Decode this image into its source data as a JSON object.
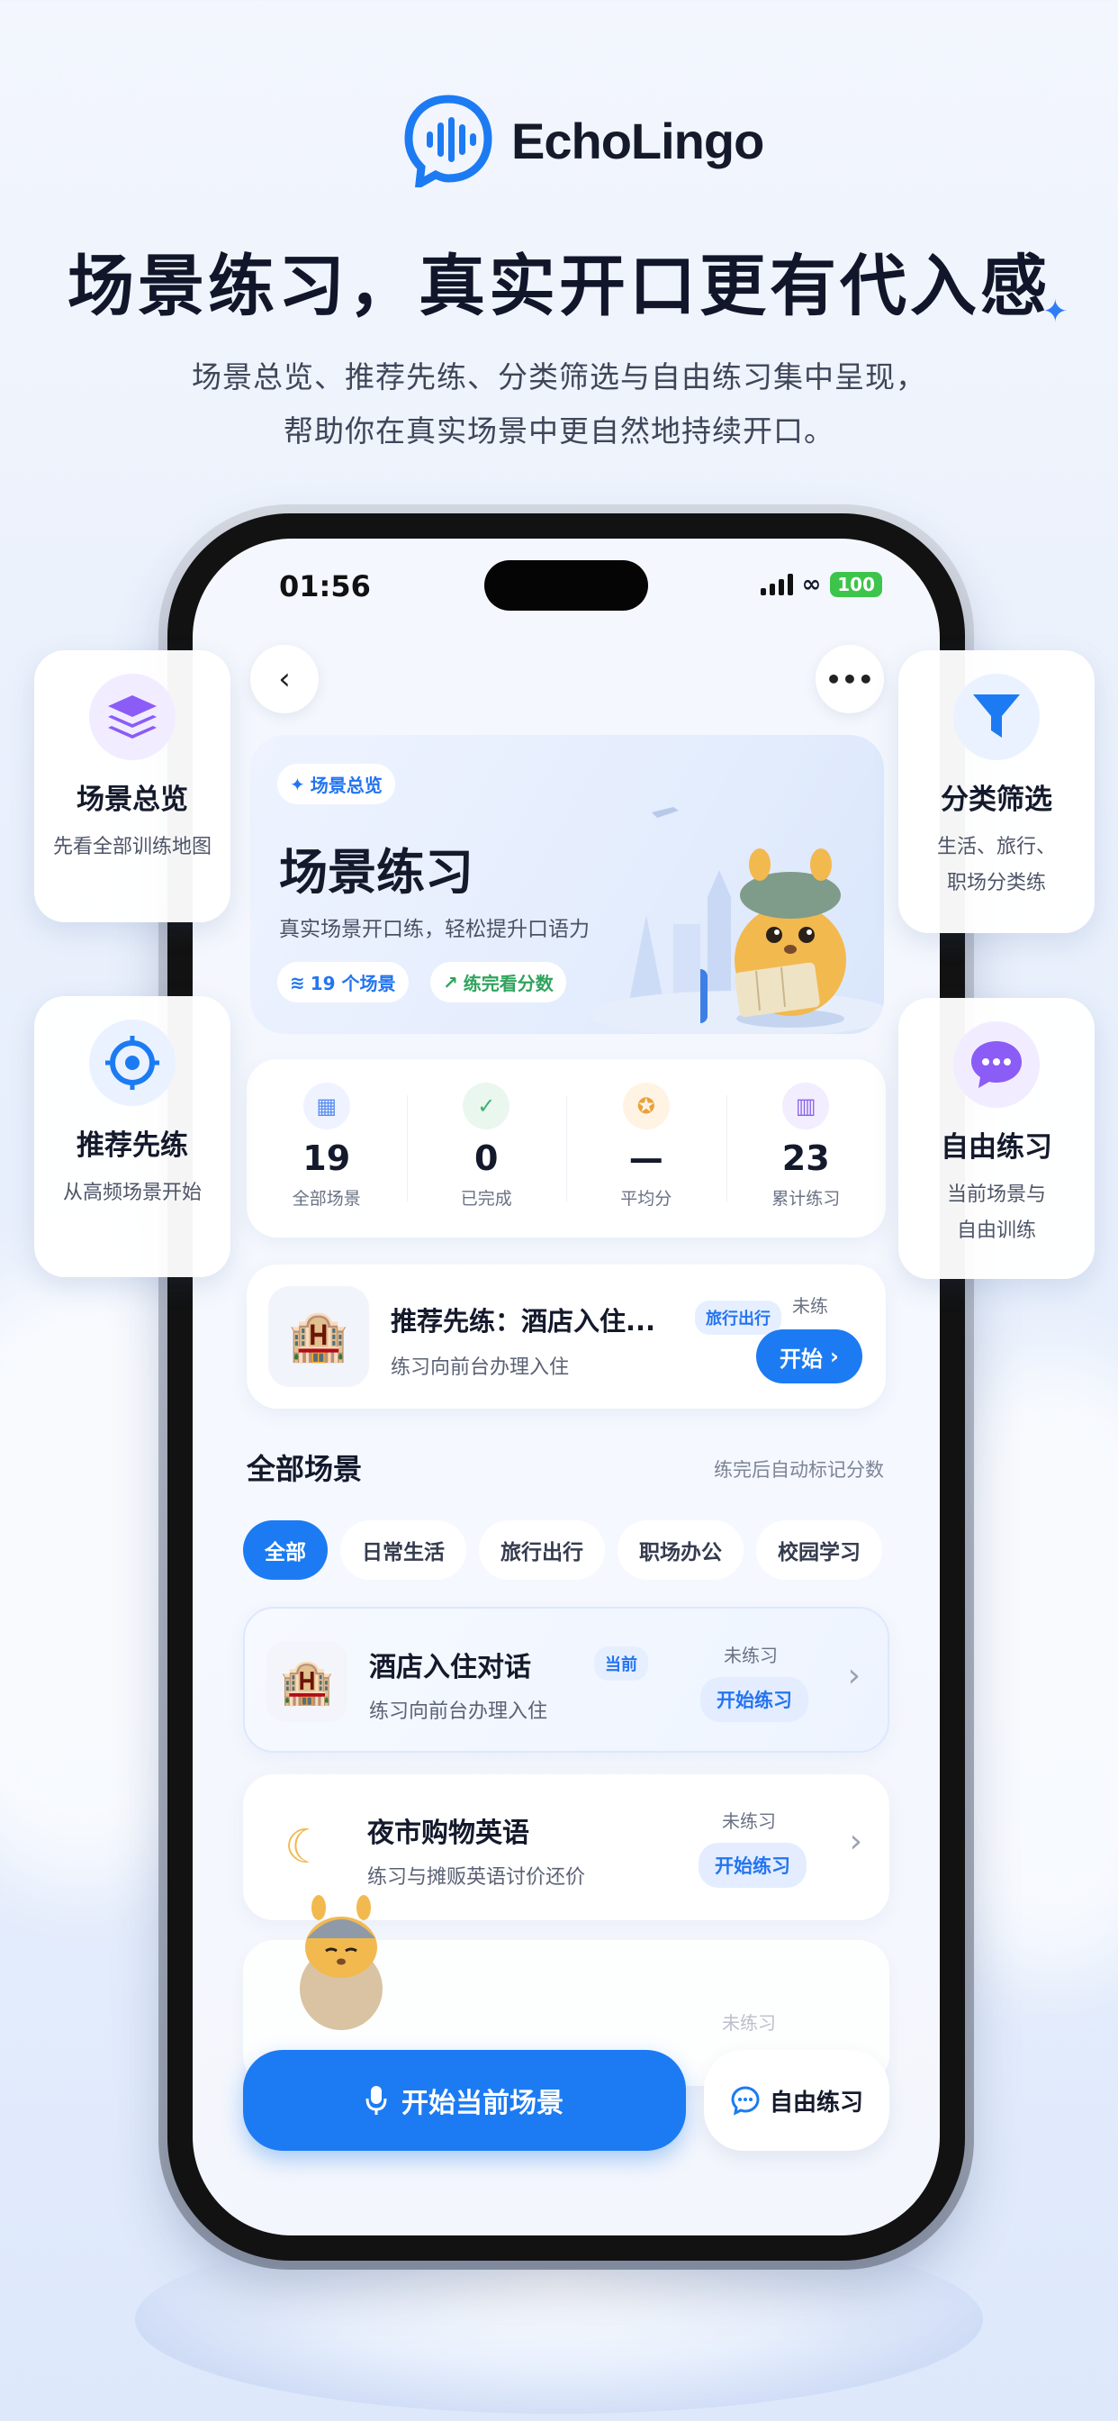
{
  "brand": {
    "name": "EchoLingo"
  },
  "headline": "场景练习，真实开口更有代入感",
  "subtitle": [
    "场景总览、推荐先练、分类筛选与自由练习集中呈现，",
    "帮助你在真实场景中更自然地持续开口。"
  ],
  "status_bar": {
    "time": "01:56",
    "battery": "100"
  },
  "features": [
    {
      "icon": "layers-icon",
      "title": "场景总览",
      "desc": [
        "先看全部训练地图"
      ]
    },
    {
      "icon": "target-icon",
      "title": "推荐先练",
      "desc": [
        "从高频场景开始"
      ]
    },
    {
      "icon": "filter-icon",
      "title": "分类筛选",
      "desc": [
        "生活、旅行、",
        "职场分类练"
      ]
    },
    {
      "icon": "chat-bubble-icon",
      "title": "自由练习",
      "desc": [
        "当前场景与",
        "自由训练"
      ]
    }
  ],
  "hero": {
    "badge": "场景总览",
    "title": "场景练习",
    "subtitle": "真实场景开口练，轻松提升口语力",
    "pill_count": "19 个场景",
    "pill_score": "练完看分数"
  },
  "stats": [
    {
      "icon": "grid-icon",
      "value": "19",
      "label": "全部场景",
      "color": "#5b8def",
      "bg": "#eef3ff"
    },
    {
      "icon": "check-circle-icon",
      "value": "0",
      "label": "已完成",
      "color": "#3fb26b",
      "bg": "#eaf7ef"
    },
    {
      "icon": "medal-icon",
      "value": "—",
      "label": "平均分",
      "color": "#e9a13b",
      "bg": "#fff4e3"
    },
    {
      "icon": "bar-chart-icon",
      "value": "23",
      "label": "累计练习",
      "color": "#8a63e8",
      "bg": "#f2edff"
    }
  ],
  "recommend": {
    "title": "推荐先练：酒店入住...",
    "tag": "旅行出行",
    "desc": "练习向前台办理入住",
    "state": "未练",
    "button": "开始"
  },
  "section": {
    "title": "全部场景",
    "hint": "练完后自动标记分数"
  },
  "chips": [
    "全部",
    "日常生活",
    "旅行出行",
    "职场办公",
    "校园学习"
  ],
  "scenes": [
    {
      "title": "酒店入住对话",
      "current_tag": "当前",
      "desc": "练习向前台办理入住",
      "state": "未练习",
      "button": "开始练习"
    },
    {
      "title": "夜市购物英语",
      "desc": "练习与摊贩英语讨价还价",
      "state": "未练习",
      "button": "开始练习"
    },
    {
      "state": "未练习"
    }
  ],
  "bottom": {
    "primary": "开始当前场景",
    "secondary": "自由练习"
  }
}
